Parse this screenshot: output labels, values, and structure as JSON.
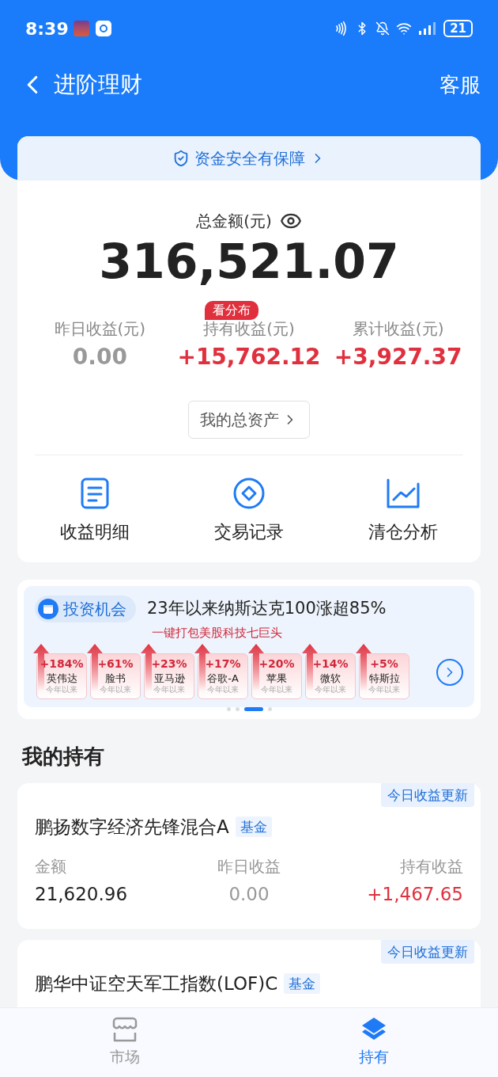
{
  "status_bar": {
    "time": "8:39",
    "battery": "21"
  },
  "header": {
    "title": "进阶理财",
    "action": "客服"
  },
  "safety_banner": "资金安全有保障",
  "total": {
    "label": "总金额(元)",
    "value": "316,521.07"
  },
  "stats": [
    {
      "label": "昨日收益(元)",
      "value": "0.00",
      "kind": "flat"
    },
    {
      "label": "持有收益(元)",
      "value": "+15,762.12",
      "kind": "up",
      "badge": "看分布"
    },
    {
      "label": "累计收益(元)",
      "value": "+3,927.37",
      "kind": "up"
    }
  ],
  "assets_button": "我的总资产",
  "shortcuts": [
    {
      "label": "收益明细",
      "kind": "list"
    },
    {
      "label": "交易记录",
      "kind": "record"
    },
    {
      "label": "清仓分析",
      "kind": "chart"
    }
  ],
  "promo": {
    "tag": "投资机会",
    "headline": "23年以来纳斯达克100涨超85%",
    "subtitle": "一键打包美股科技七巨头",
    "stocks": [
      {
        "change": "+184%",
        "name": "英伟达",
        "period": "今年以来"
      },
      {
        "change": "+61%",
        "name": "脸书",
        "period": "今年以来"
      },
      {
        "change": "+23%",
        "name": "亚马逊",
        "period": "今年以来"
      },
      {
        "change": "+17%",
        "name": "谷歌-A",
        "period": "今年以来"
      },
      {
        "change": "+20%",
        "name": "苹果",
        "period": "今年以来"
      },
      {
        "change": "+14%",
        "name": "微软",
        "period": "今年以来"
      },
      {
        "change": "+5%",
        "name": "特斯拉",
        "period": "今年以来"
      }
    ],
    "pages": [
      {
        "selected": false
      },
      {
        "selected": false
      },
      {
        "selected": true
      },
      {
        "selected": false
      }
    ]
  },
  "holdings_title": "我的持有",
  "holdings": [
    {
      "badge": "今日收益更新",
      "name": "鹏扬数字经济先锋混合A",
      "tag": "基金",
      "metrics": [
        {
          "label": "金额",
          "value": "21,620.96",
          "kind": "neutral"
        },
        {
          "label": "昨日收益",
          "value": "0.00",
          "kind": "flat"
        },
        {
          "label": "持有收益",
          "value": "+1,467.65",
          "kind": "up"
        }
      ]
    },
    {
      "badge": "今日收益更新",
      "name": "鹏华中证空天军工指数(LOF)C",
      "tag": "基金"
    }
  ],
  "tab_bar": [
    {
      "label": "市场",
      "kind": "market",
      "selected": false
    },
    {
      "label": "持有",
      "kind": "holdings",
      "selected": true
    }
  ]
}
